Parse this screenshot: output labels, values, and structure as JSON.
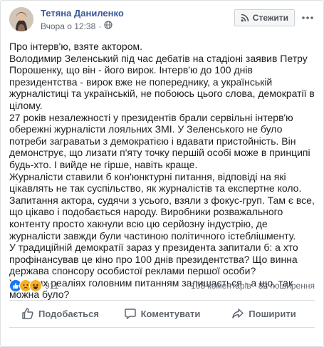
{
  "post": {
    "author": "Тетяна Даниленко",
    "timestamp": "Вчора о 12:38",
    "privacy_icon": "globe-icon",
    "follow_label": "Стежити",
    "more_icon": "more-horizontal-icon",
    "paragraphs": [
      "Про інтерв'ю, взяте актором.",
      "Володимир Зеленський під час дебатів на стадіоні заявив Петру Порошенку, що він - його вирок. Інтерв'ю до 100 днів президентства - вирок вже не попереднику, а українській журналістиці та українській, не побоюсь цього слова, демократії в цілому.",
      "27 років незалежності у президентів брали сервільні інтерв'ю обережні журналісти лояльних ЗМІ. У Зеленського не було потреби заграватьи з демократією і вдавати пристойність. Він демонструє, що лизати п'яту точку першій особі може в принципі будь-хто. І вийде не гірше, навіть краще.",
      "Журналісти ставили б кон'юнктурні питання, відповіді на які цікавлять не так суспільство, як журналістів та експертне коло.",
      "Запитання актора, судячи з усього, взяли з фокус-груп. Там є все, що цікаво і подобається народу. Виробники розважального контенту просто хакнули всю цю серйозну індустрію, де журналісти завжди були частиною політичного істеблішменту.",
      "У традиційній демократії зараз у президента запитали б: а хто профінансував це кіно про 100 днів президентства? Що винна держава спонсору особистої реклами першої особи?",
      "У наших реаліях головним питанням залишається - а що, так можна було?"
    ]
  },
  "stats": {
    "reaction_icons": [
      "like-reaction-icon",
      "sad-reaction-icon",
      "haha-reaction-icon"
    ],
    "reaction_count": "911",
    "comments": "108 коментарів",
    "shares": "82 поширення"
  },
  "actions": {
    "like": "Подобається",
    "comment": "Коментувати",
    "share": "Поширити"
  },
  "colors": {
    "author_link": "#385898",
    "secondary_text": "#606770",
    "like_blue": "#1877f2",
    "sad_yellow": "#f7b125"
  }
}
